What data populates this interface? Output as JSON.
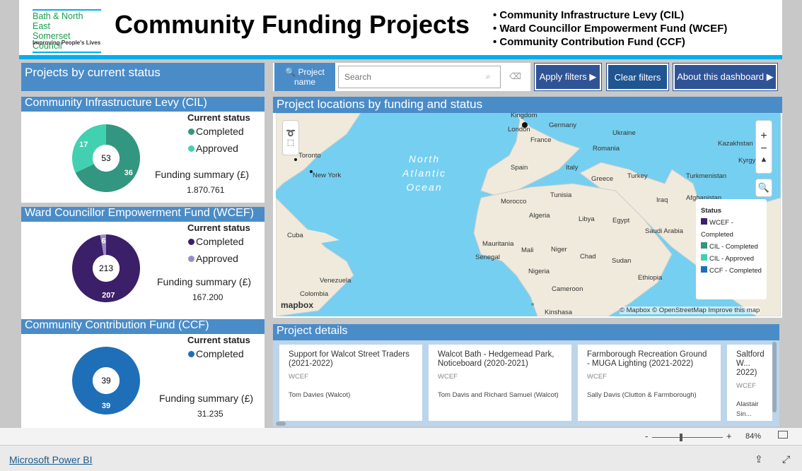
{
  "header": {
    "logo_line1": "Bath & North East",
    "logo_line2": "Somerset Council",
    "logo_tagline": "Improving People's Lives",
    "title": "Community Funding Projects",
    "bullets": [
      "• Community Infrastructure Levy (CIL)",
      "• Ward Councillor Empowerment Fund (WCEF)",
      "• Community Contribution Fund (CCF)"
    ]
  },
  "left": {
    "title": "Projects by current status",
    "panels": [
      {
        "title": "Community Infrastructure Levy (CIL)",
        "legend_title": "Current status",
        "legend": [
          {
            "label": "Completed",
            "color": "#339680"
          },
          {
            "label": "Approved",
            "color": "#41d1b0"
          }
        ],
        "total": "53",
        "segments": [
          {
            "value": 36,
            "color": "#339680",
            "label": "36"
          },
          {
            "value": 17,
            "color": "#41d1b0",
            "label": "17"
          }
        ],
        "funding_label": "Funding summary (£)",
        "funding_value": "1.870.761"
      },
      {
        "title": "Ward Councillor Empowerment Fund (WCEF)",
        "legend_title": "Current status",
        "legend": [
          {
            "label": "Completed",
            "color": "#3b1f69"
          },
          {
            "label": "Approved",
            "color": "#9d8ac9"
          }
        ],
        "total": "213",
        "segments": [
          {
            "value": 207,
            "color": "#3b1f69",
            "label": "207"
          },
          {
            "value": 6,
            "color": "#9d8ac9",
            "label": "6"
          }
        ],
        "funding_label": "Funding summary (£)",
        "funding_value": "167.200"
      },
      {
        "title": "Community Contribution Fund (CCF)",
        "legend_title": "Current status",
        "legend": [
          {
            "label": "Completed",
            "color": "#1f6fb8"
          }
        ],
        "total": "39",
        "segments": [
          {
            "value": 39,
            "color": "#1f6fb8",
            "label": "39"
          }
        ],
        "funding_label": "Funding summary (£)",
        "funding_value": "31.235"
      }
    ]
  },
  "filters": {
    "label_line1": "Project",
    "label_line2": "name",
    "search_placeholder": "Search",
    "apply": "Apply filters ▶",
    "clear": "Clear filters",
    "about": "About this dashboard ▶"
  },
  "map": {
    "title": "Project locations by funding and status",
    "ocean": [
      "North",
      "Atlantic",
      "Ocean"
    ],
    "labels": [
      "Kingdom",
      "London",
      "Germany",
      "France",
      "Ukraine",
      "Romania",
      "Kazakhstan",
      "Spain",
      "Italy",
      "Greece",
      "Turkey",
      "Turkmenistan",
      "Toronto",
      "New York",
      "Tunisia",
      "Morocco",
      "Iraq",
      "Afghanistan",
      "Algeria",
      "Libya",
      "Egypt",
      "Saudi Arabia",
      "Cuba",
      "Mauritania",
      "Mali",
      "Niger",
      "Chad",
      "Sudan",
      "Senegal",
      "Nigeria",
      "Ethiopia",
      "Venezuela",
      "Colombia",
      "Cameroon",
      "Kinshasa",
      "Kyrgy"
    ],
    "legend_title": "Status",
    "legend": [
      {
        "label": "WCEF - Completed",
        "color": "#3b1f69"
      },
      {
        "label": "CIL - Completed",
        "color": "#339680"
      },
      {
        "label": "CIL - Approved",
        "color": "#41d1b0"
      },
      {
        "label": "CCF - Completed",
        "color": "#1f6fb8"
      }
    ],
    "attribution": "© Mapbox © OpenStreetMap  Improve this map",
    "brand": "mapbox",
    "zoom_in": "+",
    "zoom_out": "−"
  },
  "details": {
    "title": "Project details",
    "cards": [
      {
        "title": "Support for Walcot Street Traders (2021-2022)",
        "fund": "WCEF",
        "people": "Tom Davies (Walcot)"
      },
      {
        "title": "Walcot Bath - Hedgemead Park, Noticeboard (2020-2021)",
        "fund": "WCEF",
        "people": "Tom Davis and Richard Samuel (Walcot)"
      },
      {
        "title": "Farmborough Recreation Ground - MUGA Lighting (2021-2022)",
        "fund": "WCEF",
        "people": "Sally Davis (Clutton & Farmborough)"
      },
      {
        "title": "Saltford W... 2022)",
        "fund": "WCEF",
        "people": "Alastair Sin..."
      }
    ]
  },
  "statusbar": {
    "minus": "-",
    "plus": "+",
    "zoom": "84%",
    "zoom_value": 84
  },
  "footer": {
    "brand": "Microsoft Power BI"
  }
}
